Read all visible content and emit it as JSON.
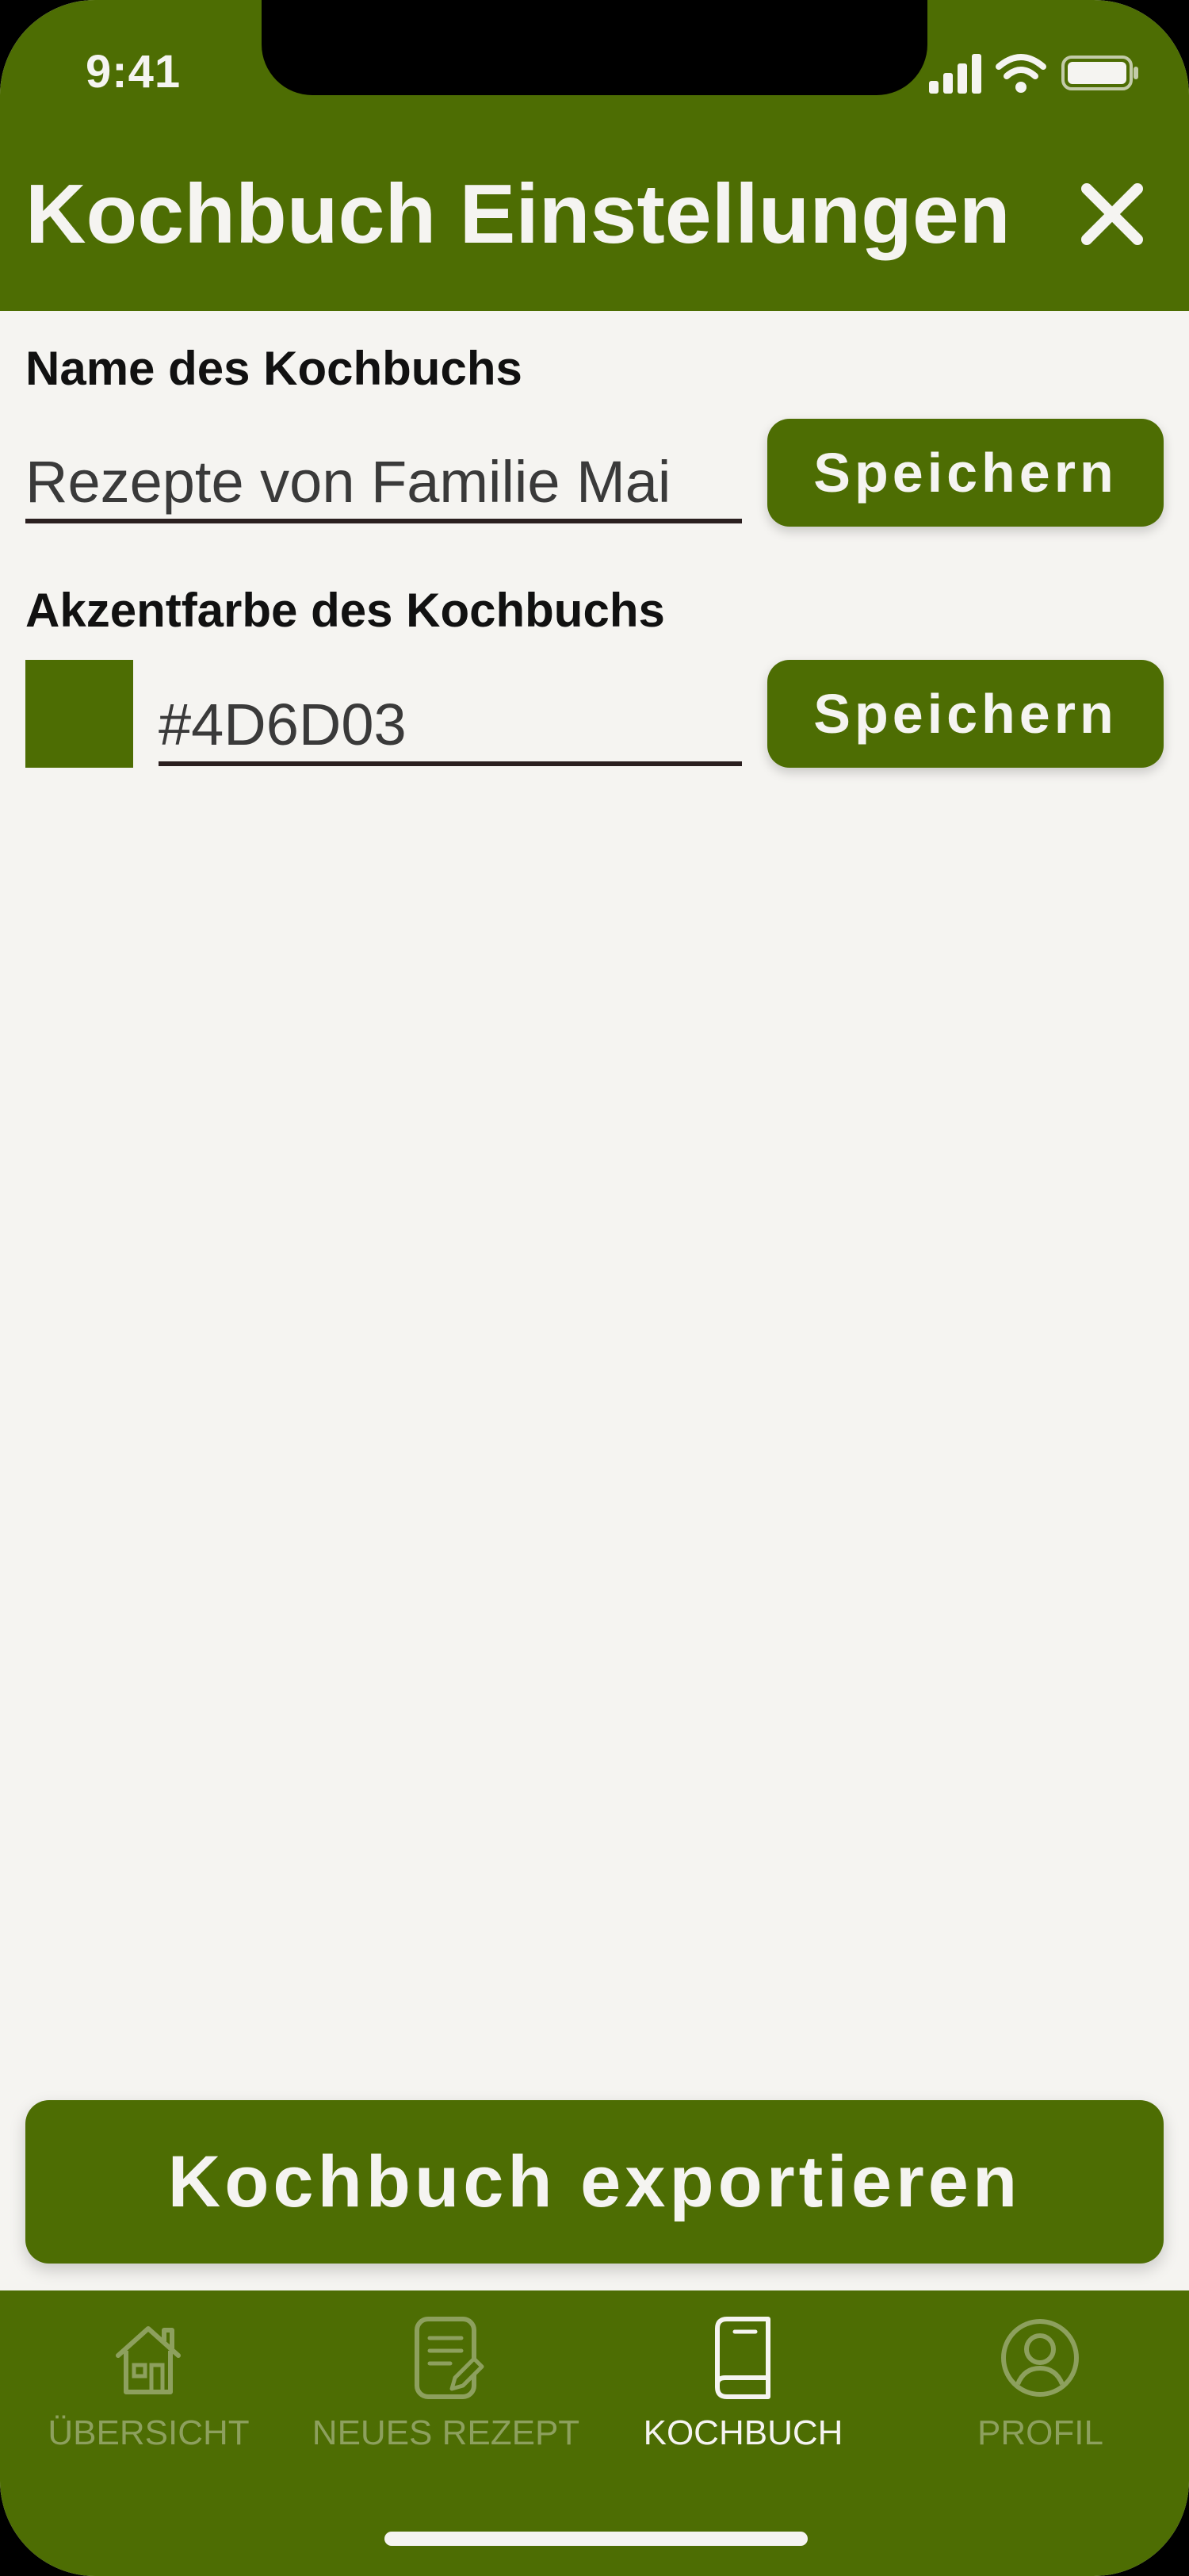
{
  "status_bar": {
    "time": "9:41"
  },
  "header": {
    "title": "Kochbuch Einstellungen"
  },
  "name_section": {
    "label": "Name des Kochbuchs",
    "value": "Rezepte von Familie Mai",
    "save_label": "Speichern"
  },
  "color_section": {
    "label": "Akzentfarbe des Kochbuchs",
    "value": "#4D6D03",
    "swatch_color": "#4D6D03",
    "save_label": "Speichern"
  },
  "export_button": {
    "label": "Kochbuch exportieren"
  },
  "tabs": [
    {
      "label": "ÜBERSICHT",
      "icon": "home-icon",
      "active": false
    },
    {
      "label": "NEUES REZEPT",
      "icon": "document-edit-icon",
      "active": false
    },
    {
      "label": "KOCHBUCH",
      "icon": "book-icon",
      "active": true
    },
    {
      "label": "PROFIL",
      "icon": "user-circle-icon",
      "active": false
    }
  ],
  "colors": {
    "accent": "#4D6D03",
    "background": "#F5F4F1",
    "tab_inactive": "#8DA05E",
    "tab_active": "#F5F4F1"
  }
}
